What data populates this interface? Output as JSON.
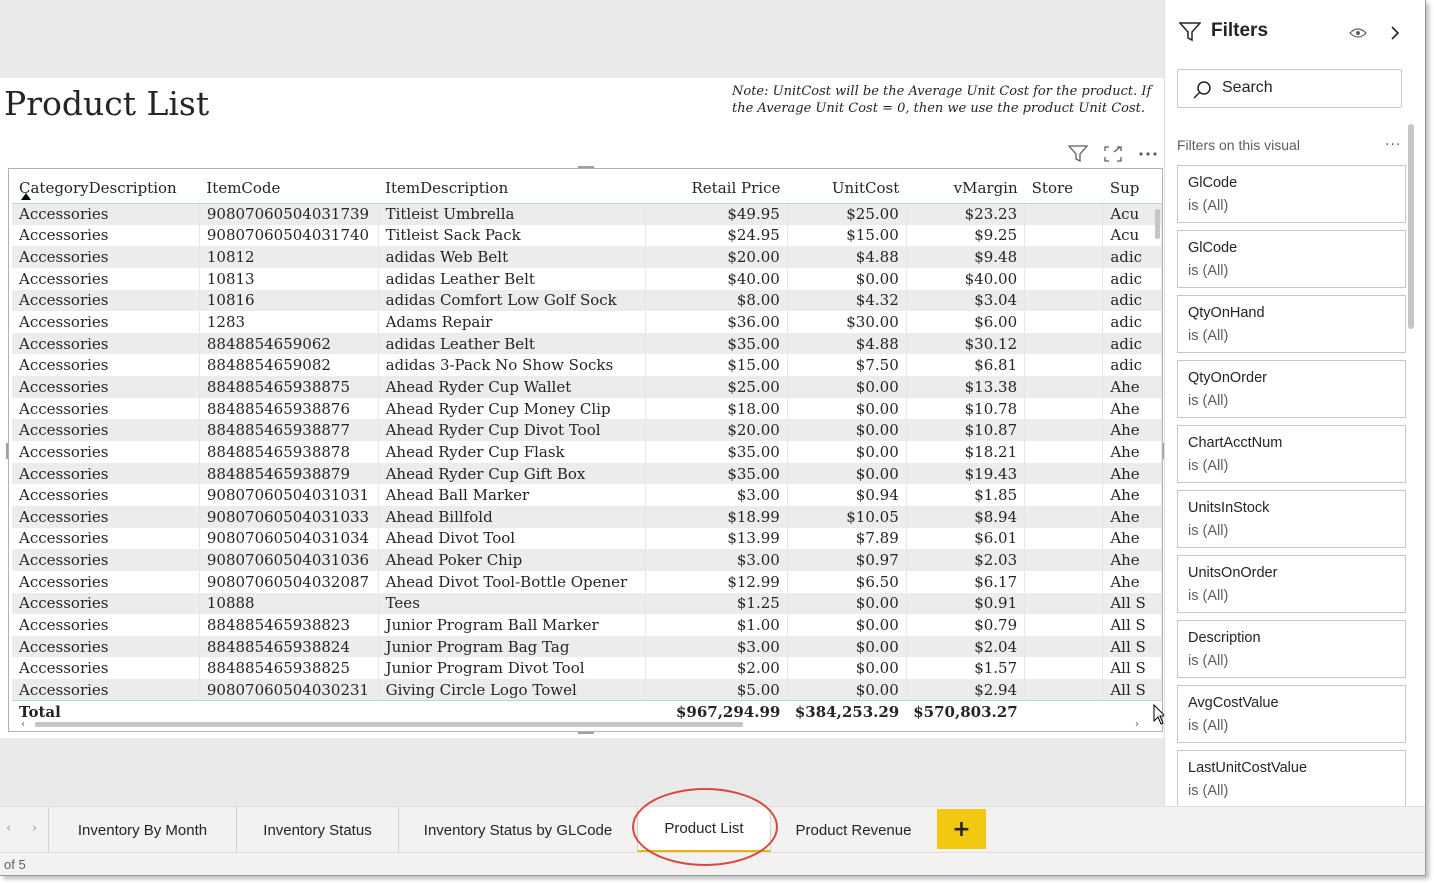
{
  "page": {
    "title": "Product List",
    "note": "Note: UnitCost will be the Average Unit Cost for the product.  If the Average Unit Cost = 0, then we use the product Unit Cost."
  },
  "table": {
    "columns": [
      "CategoryDescription",
      "ItemCode",
      "ItemDescription",
      "Retail Price",
      "UnitCost",
      "vMargin",
      "Store",
      "Sup"
    ],
    "rows": [
      [
        "Accessories",
        "90807060504031739",
        "Titleist Umbrella",
        "$49.95",
        "$25.00",
        "$23.23",
        "",
        "Acu"
      ],
      [
        "Accessories",
        "90807060504031740",
        "Titleist Sack Pack",
        "$24.95",
        "$15.00",
        "$9.25",
        "",
        "Acu"
      ],
      [
        "Accessories",
        "10812",
        "adidas Web Belt",
        "$20.00",
        "$4.88",
        "$9.48",
        "",
        "adic"
      ],
      [
        "Accessories",
        "10813",
        "adidas Leather Belt",
        "$40.00",
        "$0.00",
        "$40.00",
        "",
        "adic"
      ],
      [
        "Accessories",
        "10816",
        "adidas Comfort Low Golf Sock",
        "$8.00",
        "$4.32",
        "$3.04",
        "",
        "adic"
      ],
      [
        "Accessories",
        "1283",
        "Adams Repair",
        "$36.00",
        "$30.00",
        "$6.00",
        "",
        "adic"
      ],
      [
        "Accessories",
        "8848854659062",
        "adidas Leather Belt",
        "$35.00",
        "$4.88",
        "$30.12",
        "",
        "adic"
      ],
      [
        "Accessories",
        "8848854659082",
        "adidas 3-Pack No Show Socks",
        "$15.00",
        "$7.50",
        "$6.81",
        "",
        "adic"
      ],
      [
        "Accessories",
        "884885465938875",
        "Ahead Ryder Cup Wallet",
        "$25.00",
        "$0.00",
        "$13.38",
        "",
        "Ahe"
      ],
      [
        "Accessories",
        "884885465938876",
        "Ahead Ryder Cup Money Clip",
        "$18.00",
        "$0.00",
        "$10.78",
        "",
        "Ahe"
      ],
      [
        "Accessories",
        "884885465938877",
        "Ahead Ryder Cup Divot Tool",
        "$20.00",
        "$0.00",
        "$10.87",
        "",
        "Ahe"
      ],
      [
        "Accessories",
        "884885465938878",
        "Ahead Ryder Cup Flask",
        "$35.00",
        "$0.00",
        "$18.21",
        "",
        "Ahe"
      ],
      [
        "Accessories",
        "884885465938879",
        "Ahead Ryder Cup Gift Box",
        "$35.00",
        "$0.00",
        "$19.43",
        "",
        "Ahe"
      ],
      [
        "Accessories",
        "90807060504031031",
        "Ahead Ball Marker",
        "$3.00",
        "$0.94",
        "$1.85",
        "",
        "Ahe"
      ],
      [
        "Accessories",
        "90807060504031033",
        "Ahead Billfold",
        "$18.99",
        "$10.05",
        "$8.94",
        "",
        "Ahe"
      ],
      [
        "Accessories",
        "90807060504031034",
        "Ahead Divot Tool",
        "$13.99",
        "$7.89",
        "$6.01",
        "",
        "Ahe"
      ],
      [
        "Accessories",
        "90807060504031036",
        "Ahead Poker Chip",
        "$3.00",
        "$0.97",
        "$2.03",
        "",
        "Ahe"
      ],
      [
        "Accessories",
        "90807060504032087",
        "Ahead Divot Tool-Bottle Opener",
        "$12.99",
        "$6.50",
        "$6.17",
        "",
        "Ahe"
      ],
      [
        "Accessories",
        "10888",
        "Tees",
        "$1.25",
        "$0.00",
        "$0.91",
        "",
        "All S"
      ],
      [
        "Accessories",
        "884885465938823",
        "Junior Program Ball Marker",
        "$1.00",
        "$0.00",
        "$0.79",
        "",
        "All S"
      ],
      [
        "Accessories",
        "884885465938824",
        "Junior Program Bag Tag",
        "$3.00",
        "$0.00",
        "$2.04",
        "",
        "All S"
      ],
      [
        "Accessories",
        "884885465938825",
        "Junior Program Divot Tool",
        "$2.00",
        "$0.00",
        "$1.57",
        "",
        "All S"
      ],
      [
        "Accessories",
        "90807060504030231",
        "Giving Circle Logo Towel",
        "$5.00",
        "$0.00",
        "$2.94",
        "",
        "All S"
      ]
    ],
    "total": {
      "label": "Total",
      "retail_price": "$967,294.99",
      "unit_cost": "$384,253.29",
      "vmargin": "$570,803.27"
    }
  },
  "filters": {
    "title": "Filters",
    "search_placeholder": "Search",
    "section_label": "Filters on this visual",
    "more": "...",
    "items": [
      {
        "name": "GlCode",
        "value": "is (All)"
      },
      {
        "name": "GlCode",
        "value": "is (All)"
      },
      {
        "name": "QtyOnHand",
        "value": "is (All)"
      },
      {
        "name": "QtyOnOrder",
        "value": "is (All)"
      },
      {
        "name": "ChartAcctNum",
        "value": "is (All)"
      },
      {
        "name": "UnitsInStock",
        "value": "is (All)"
      },
      {
        "name": "UnitsOnOrder",
        "value": "is (All)"
      },
      {
        "name": "Description",
        "value": "is (All)"
      },
      {
        "name": "AvgCostValue",
        "value": "is (All)"
      },
      {
        "name": "LastUnitCostValue",
        "value": "is (All)"
      }
    ]
  },
  "tabs": [
    {
      "label": "Inventory By Month",
      "active": false
    },
    {
      "label": "Inventory Status",
      "active": false
    },
    {
      "label": "Inventory Status by GLCode",
      "active": false
    },
    {
      "label": "Product List",
      "active": true
    },
    {
      "label": "Product Revenue",
      "active": false
    }
  ],
  "add_tab_label": "+",
  "page_count": "of 5",
  "colors": {
    "accent": "#f2c811",
    "highlight_oval": "#d9473f",
    "active_tab_underline": "#e8b600"
  }
}
